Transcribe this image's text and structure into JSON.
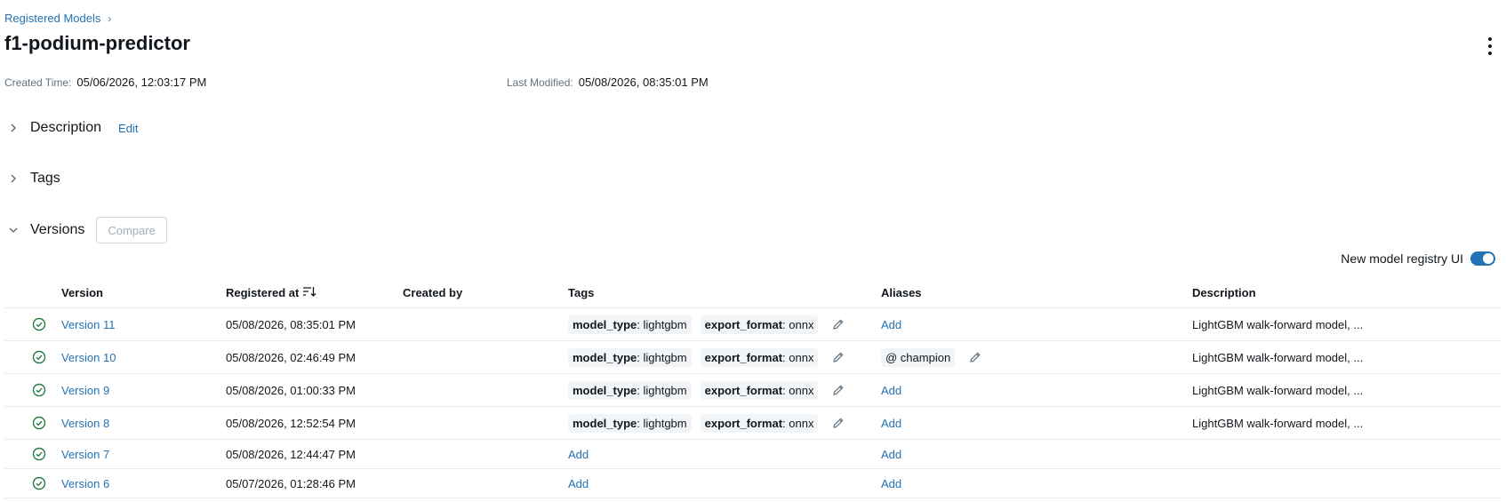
{
  "breadcrumb": {
    "parent": "Registered Models",
    "separator": "›"
  },
  "title": "f1-podium-predictor",
  "meta": {
    "created_label": "Created Time:",
    "created_value": "05/06/2026, 12:03:17 PM",
    "modified_label": "Last Modified:",
    "modified_value": "05/08/2026, 08:35:01 PM"
  },
  "sections": {
    "description": {
      "label": "Description",
      "edit": "Edit",
      "chevron": "chevron-right-icon"
    },
    "tags": {
      "label": "Tags",
      "chevron": "chevron-right-icon"
    },
    "versions": {
      "label": "Versions",
      "compare": "Compare",
      "chevron": "chevron-down-icon"
    }
  },
  "toggle": {
    "label": "New model registry UI",
    "on": true
  },
  "table": {
    "headers": {
      "version": "Version",
      "registered_at": "Registered at",
      "created_by": "Created by",
      "tags": "Tags",
      "aliases": "Aliases",
      "description": "Description"
    },
    "rows": [
      {
        "version": "Version 11",
        "registered": "05/08/2026, 08:35:01 PM",
        "created_by": "",
        "tag1_key": "model_type",
        "tag1_val": ": lightgbm",
        "tag2_key": "export_format",
        "tag2_val": ": onnx",
        "tags_add": "",
        "alias": "",
        "alias_add": "Add",
        "description": "LightGBM walk-forward model, ..."
      },
      {
        "version": "Version 10",
        "registered": "05/08/2026, 02:46:49 PM",
        "created_by": "",
        "tag1_key": "model_type",
        "tag1_val": ": lightgbm",
        "tag2_key": "export_format",
        "tag2_val": ": onnx",
        "tags_add": "",
        "alias": "@ champion",
        "alias_add": "",
        "description": "LightGBM walk-forward model, ..."
      },
      {
        "version": "Version 9",
        "registered": "05/08/2026, 01:00:33 PM",
        "created_by": "",
        "tag1_key": "model_type",
        "tag1_val": ": lightgbm",
        "tag2_key": "export_format",
        "tag2_val": ": onnx",
        "tags_add": "",
        "alias": "",
        "alias_add": "Add",
        "description": "LightGBM walk-forward model, ..."
      },
      {
        "version": "Version 8",
        "registered": "05/08/2026, 12:52:54 PM",
        "created_by": "",
        "tag1_key": "model_type",
        "tag1_val": ": lightgbm",
        "tag2_key": "export_format",
        "tag2_val": ": onnx",
        "tags_add": "",
        "alias": "",
        "alias_add": "Add",
        "description": "LightGBM walk-forward model, ..."
      },
      {
        "version": "Version 7",
        "registered": "05/08/2026, 12:44:47 PM",
        "created_by": "",
        "tags_add": "Add",
        "alias": "",
        "alias_add": "Add",
        "description": ""
      },
      {
        "version": "Version 6",
        "registered": "05/07/2026, 01:28:46 PM",
        "created_by": "",
        "tags_add": "Add",
        "alias": "",
        "alias_add": "Add",
        "description": ""
      }
    ]
  },
  "colors": {
    "accent": "#2272b4",
    "status_ready": "#277c43",
    "muted": "#5f7281"
  }
}
